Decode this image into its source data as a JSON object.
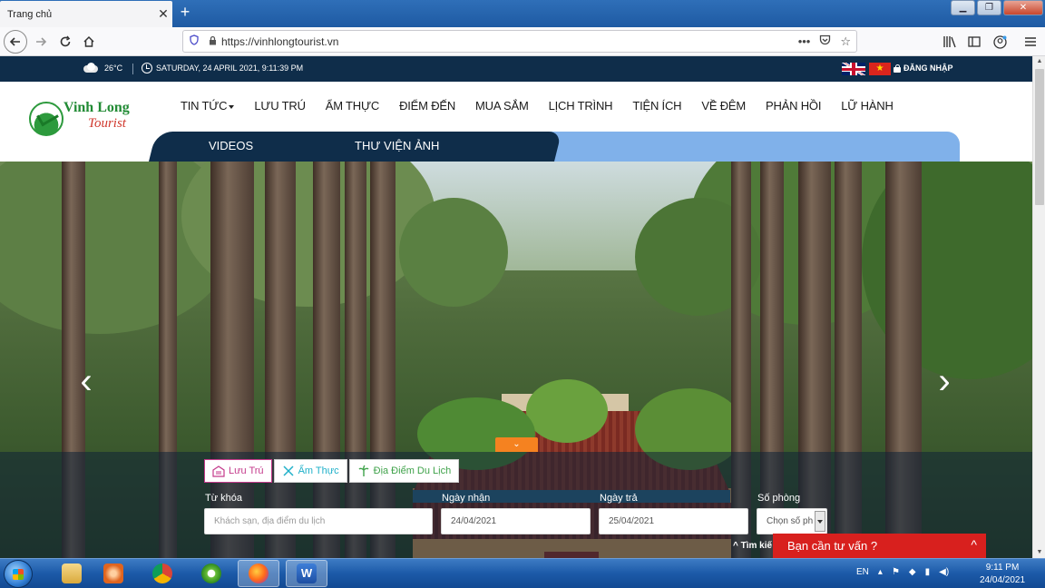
{
  "browser": {
    "tab_title": "Trang chủ",
    "tab_close": "✕",
    "new_tab": "+",
    "url": "https://vinhlongtourist.vn",
    "window_buttons": [
      "▁",
      "❐",
      "✕"
    ]
  },
  "topbar": {
    "temperature": "26°C",
    "datetime": "SATURDAY, 24 APRIL 2021, 9:11:39 PM",
    "login": "ĐĂNG NHẬP"
  },
  "logo": {
    "name": "Vinh Long",
    "sub": "Tourist"
  },
  "mainnav": {
    "items": [
      "TIN TỨC",
      "LƯU TRÚ",
      "ẨM THỰC",
      "ĐIỂM ĐẾN",
      "MUA SẮM",
      "LỊCH TRÌNH",
      "TIỆN ÍCH",
      "VỀ ĐÊM",
      "PHẢN HỒI",
      "LỮ HÀNH"
    ]
  },
  "subnav": {
    "items": [
      "VIDEOS",
      "THƯ VIỆN ẢNH"
    ]
  },
  "hero": {
    "prev": "‹",
    "next": "›",
    "toggle": "⌄"
  },
  "search": {
    "tabs": [
      "Lưu Trú",
      "Ẩm Thực",
      "Địa Điểm Du Lịch"
    ],
    "keyword_label": "Từ khóa",
    "keyword_placeholder": "Khách sạn, địa điểm du lịch",
    "checkin_label": "Ngày nhận",
    "checkin_value": "24/04/2021",
    "checkout_label": "Ngày trả",
    "checkout_value": "25/04/2021",
    "rooms_label": "Số phòng",
    "rooms_value": "Chọn số ph",
    "advanced": "Tìm kiế"
  },
  "chat": {
    "label": "Bạn cần tư vấn ?",
    "chevron": "^"
  },
  "taskbar": {
    "lang": "EN",
    "time": "9:11 PM",
    "date": "24/04/2021"
  }
}
